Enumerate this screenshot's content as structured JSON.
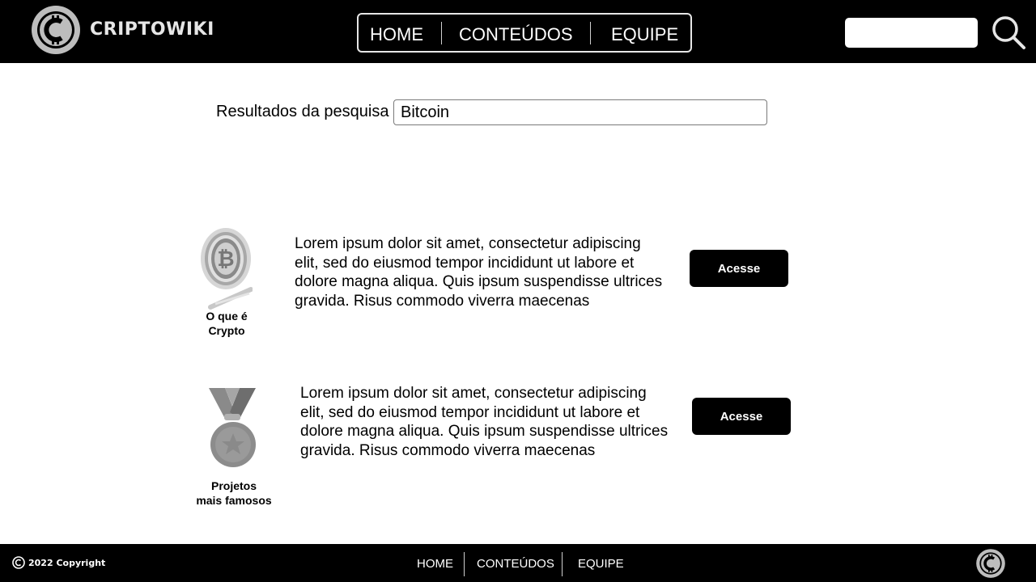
{
  "header": {
    "brand": "CRIPTOWIKI",
    "nav": [
      "HOME",
      "CONTEÚDOS",
      "EQUIPE"
    ],
    "search_placeholder": "",
    "search_icon": "search-icon"
  },
  "search": {
    "label": "Resultados da pesquisa",
    "value": "Bitcoin"
  },
  "results": [
    {
      "icon": "bitcoin-coin-icon",
      "caption_line1": "O que é",
      "caption_line2": "Crypto",
      "text": "Lorem ipsum dolor sit amet, consectetur adipiscing elit, sed do eiusmod tempor incididunt ut labore et dolore magna aliqua. Quis ipsum suspendisse ultrices gravida. Risus commodo viverra maecenas",
      "button": "Acesse"
    },
    {
      "icon": "medal-icon",
      "caption_line1": "Projetos",
      "caption_line2": "mais famosos",
      "text": "Lorem ipsum dolor sit amet, consectetur adipiscing elit, sed do eiusmod tempor incididunt ut labore et dolore magna aliqua. Quis ipsum suspendisse ultrices gravida. Risus commodo viverra maecenas",
      "button": "Acesse"
    }
  ],
  "footer": {
    "copyright": "2022 Copyright",
    "nav": [
      "HOME",
      "CONTEÚDOS",
      "EQUIPE"
    ]
  },
  "colors": {
    "header_bg": "#000000",
    "button_bg": "#000000",
    "logo_gray": "#bdbdbd"
  }
}
